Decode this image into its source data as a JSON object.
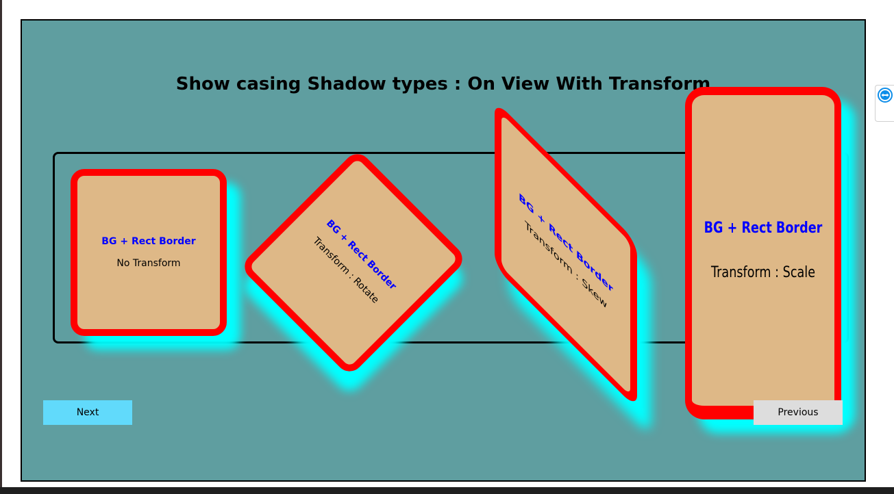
{
  "page": {
    "title": "Show casing Shadow types : On View With Transform"
  },
  "cards": [
    {
      "heading": "BG + Rect Border",
      "subtitle": "No Transform"
    },
    {
      "heading": "BG + Rect Border",
      "subtitle": "Transform : Rotate"
    },
    {
      "heading": "BG + Rect Border",
      "subtitle": "Transform : Skew"
    },
    {
      "heading": "BG + Rect Border",
      "subtitle": "Transform : Scale"
    }
  ],
  "buttons": {
    "next_label": "Next",
    "previous_label": "Previous"
  },
  "colors": {
    "canvas_background": "#5f9ea0",
    "card_background": "#deb887",
    "card_border": "#ff0000",
    "card_shadow": "#00ffff",
    "heading_text": "#0000ff",
    "next_button": "#61dafb",
    "previous_button": "#dddddd"
  },
  "icons": {
    "side_tab": "remote-control-arrows-icon"
  }
}
